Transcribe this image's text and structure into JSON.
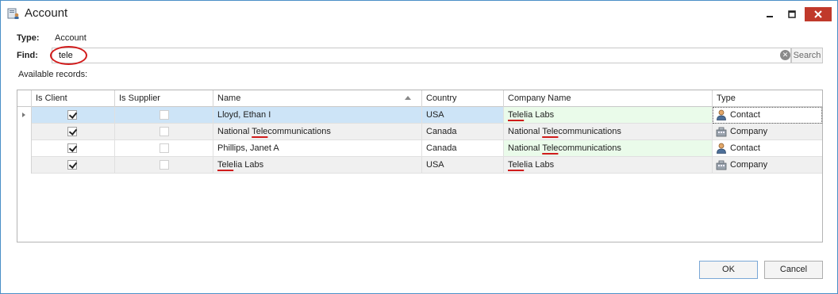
{
  "window": {
    "title": "Account"
  },
  "header": {
    "type_label": "Type:",
    "type_value": "Account",
    "find_label": "Find:",
    "available_label": "Available records:"
  },
  "search": {
    "value": "tele",
    "button_label": "Search"
  },
  "grid": {
    "columns": [
      "Is Client",
      "Is Supplier",
      "Name",
      "Country",
      "Company Name",
      "Type"
    ],
    "sort_column": "Name",
    "rows": [
      {
        "is_client": true,
        "is_supplier": false,
        "name_pre": "Lloyd, Ethan I",
        "name_hl": "",
        "name_post": "",
        "country": "USA",
        "company_pre": "",
        "company_hl": "Tele",
        "company_post": "lia Labs",
        "type": "Contact",
        "type_icon": "contact-icon",
        "selected": true
      },
      {
        "is_client": true,
        "is_supplier": false,
        "name_pre": "National ",
        "name_hl": "Tele",
        "name_post": "communications",
        "country": "Canada",
        "company_pre": "National ",
        "company_hl": "Tele",
        "company_post": "communications",
        "type": "Company",
        "type_icon": "company-icon",
        "selected": false
      },
      {
        "is_client": true,
        "is_supplier": false,
        "name_pre": "Phillips, Janet A",
        "name_hl": "",
        "name_post": "",
        "country": "Canada",
        "company_pre": "National ",
        "company_hl": "Tele",
        "company_post": "communications",
        "type": "Contact",
        "type_icon": "contact-icon",
        "selected": false
      },
      {
        "is_client": true,
        "is_supplier": false,
        "name_pre": "",
        "name_hl": "Tele",
        "name_post": "lia Labs",
        "country": "USA",
        "company_pre": "",
        "company_hl": "Tele",
        "company_post": "lia Labs",
        "type": "Company",
        "type_icon": "company-icon",
        "selected": false
      }
    ]
  },
  "buttons": {
    "ok": "OK",
    "cancel": "Cancel"
  },
  "colors": {
    "selected_row": "#cde4f7",
    "alt_row": "#f0f0f0",
    "company_cell_highlight": "#eafbea",
    "highlight_underline": "#d01c1c",
    "close_button": "#c0392b",
    "window_border": "#4a8fc7"
  }
}
